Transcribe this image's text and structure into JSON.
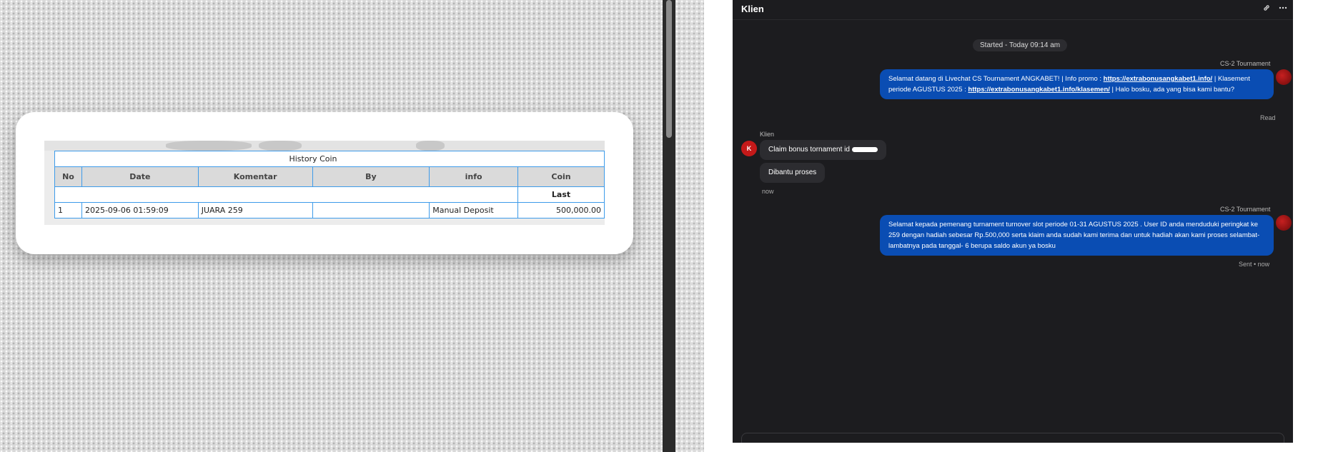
{
  "history": {
    "title": "History Coin",
    "columns": [
      "No",
      "Date",
      "Komentar",
      "By",
      "info",
      "Coin"
    ],
    "last_label": "Last",
    "rows": [
      {
        "no": "1",
        "date": "2025-09-06 01:59:09",
        "komentar": "JUARA 259",
        "by": "",
        "info": "Manual Deposit",
        "coin": "500,000.00"
      }
    ]
  },
  "chat": {
    "title": "Klien",
    "header_icons": [
      "link-icon",
      "more-icon"
    ],
    "started": "Started - Today 09:14 am",
    "messages": [
      {
        "sender": "CS-2 Tournament",
        "text_1": "Selamat datang di Livechat CS Tournament ANGKABET! | Info promo : ",
        "link_1": "https://extrabonusangkabet1.info/",
        "text_2": " | Klasement periode AGUSTUS 2025 : ",
        "link_2": "https://extrabonusangkabet1.info/klasemen/",
        "text_3": " | Halo bosku, ada yang bisa kami bantu?",
        "status": "Read"
      },
      {
        "sender": "Klien",
        "avatar": "K",
        "bubble_1": "Claim bonus tornament id",
        "bubble_2": "Dibantu proses",
        "time": "now"
      },
      {
        "sender": "CS-2 Tournament",
        "text": "Selamat kepada pemenang turnament turnover slot periode 01-31 AGUSTUS 2025 . User ID anda menduduki peringkat ke 259 dengan hadiah sebesar Rp.500,000 serta klaim anda sudah kami terima dan untuk hadiah akan kami proses selambat-lambatnya pada tanggal- 6 berupa saldo akun ya bosku",
        "status": "Sent • now"
      }
    ]
  }
}
